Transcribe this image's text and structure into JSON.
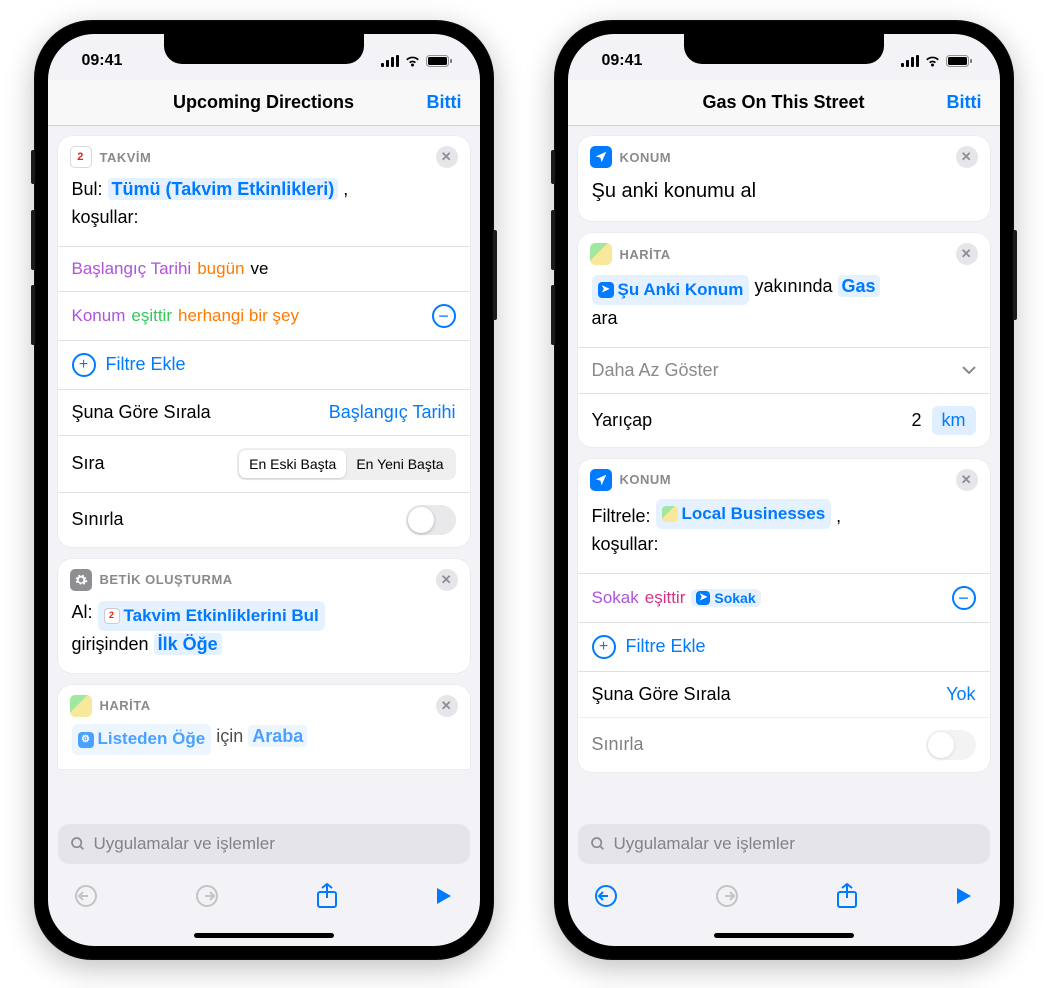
{
  "status_bar": {
    "time": "09:41"
  },
  "search_placeholder": "Uygulamalar ve işlemler",
  "common": {
    "done": "Bitti",
    "add_filter": "Filtre Ekle",
    "sort_by_label": "Şuna Göre Sırala",
    "order_label": "Sıra",
    "limit_label": "Sınırla"
  },
  "left": {
    "title": "Upcoming Directions",
    "card_calendar": {
      "header": "TAKVİM",
      "find_label": "Bul:",
      "find_token": "Tümü (Takvim Etkinlikleri)",
      "conditions_label": "koşullar:",
      "filter1_a": "Başlangıç Tarihi",
      "filter1_b": "bugün",
      "filter1_c": "ve",
      "filter2_a": "Konum",
      "filter2_b": "eşittir",
      "filter2_c": "herhangi bir şey",
      "sort_value": "Başlangıç Tarihi",
      "seg_old": "En Eski Başta",
      "seg_new": "En Yeni Başta"
    },
    "card_script": {
      "header": "BETİK OLUŞTURMA",
      "get_label": "Al:",
      "token1": "Takvim Etkinliklerini Bul",
      "middle": "girişinden",
      "token2": "İlk Öğe"
    },
    "card_maps_peek": {
      "header": "HARİTA",
      "token1": "Listeden Öğe",
      "middle": "için",
      "token2": "Araba"
    }
  },
  "right": {
    "title": "Gas On This Street",
    "card_loc1": {
      "header": "KONUM",
      "body": "Şu anki konumu al"
    },
    "card_maps": {
      "header": "HARİTA",
      "token_loc": "Şu Anki Konum",
      "near_label": "yakınında",
      "token_gas": "Gas",
      "search_label": "ara",
      "show_less": "Daha Az Göster",
      "radius_label": "Yarıçap",
      "radius_value": "2",
      "radius_unit": "km"
    },
    "card_loc2": {
      "header": "KONUM",
      "filter_label": "Filtrele:",
      "token_local": "Local Businesses",
      "conditions_label": "koşullar:",
      "filter_a": "Sokak",
      "filter_b": "eşittir",
      "filter_c": "Sokak",
      "sort_value": "Yok"
    }
  }
}
